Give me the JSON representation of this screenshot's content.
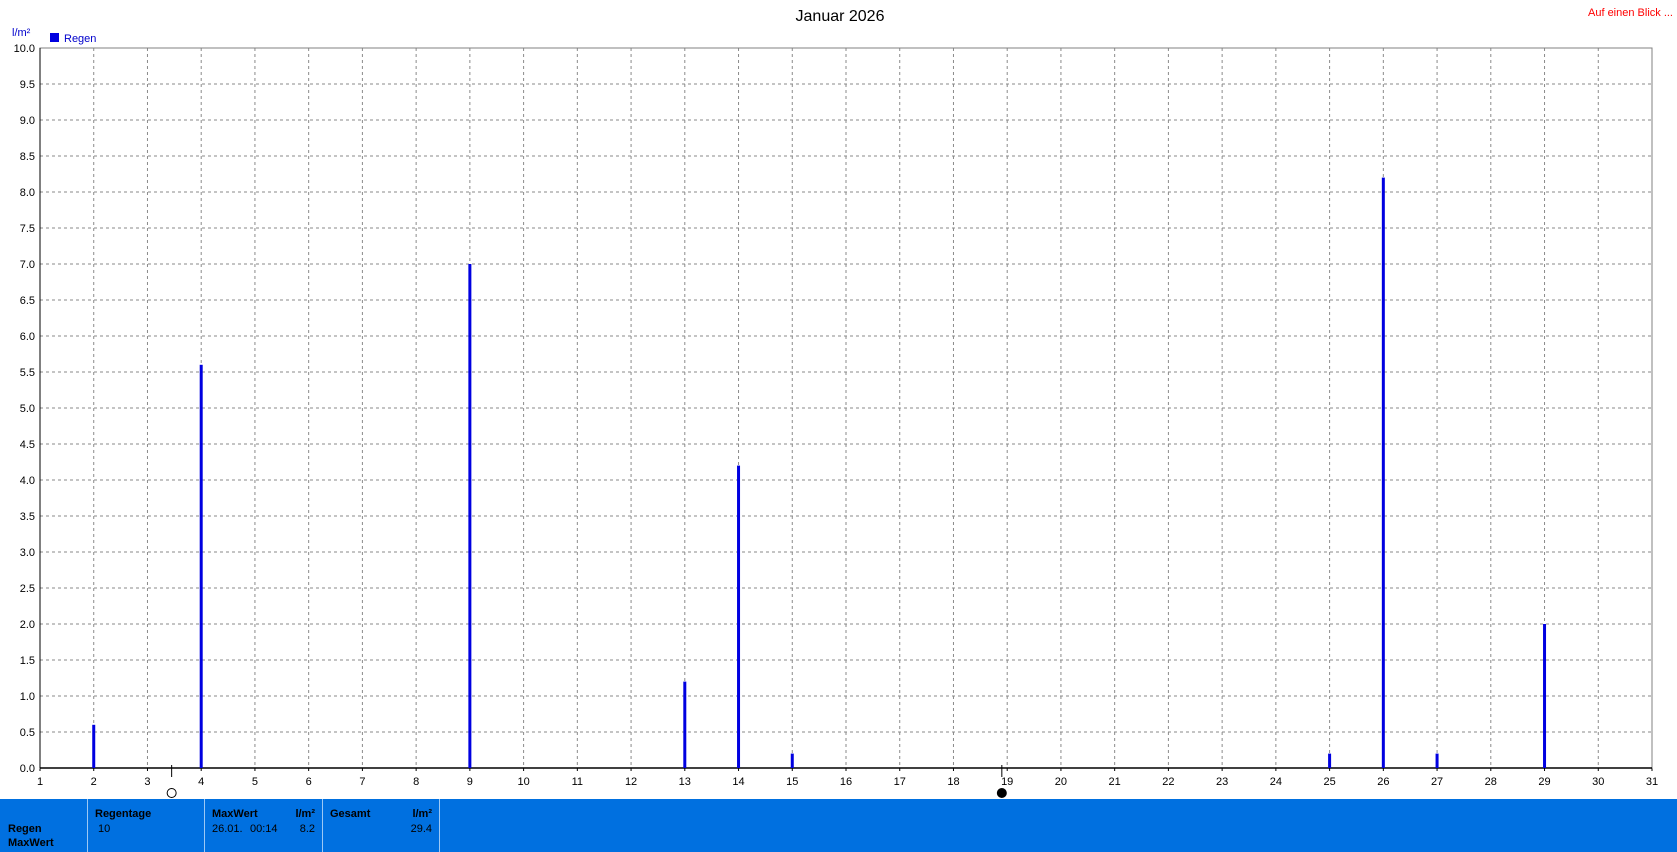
{
  "chart_data": {
    "type": "bar",
    "title": "Januar 2026",
    "ylabel": "l/m²",
    "ylim": [
      0,
      10
    ],
    "y_ticks": [
      "0.0",
      "0.5",
      "1.0",
      "1.5",
      "2.0",
      "2.5",
      "3.0",
      "3.5",
      "4.0",
      "4.5",
      "5.0",
      "5.5",
      "6.0",
      "6.5",
      "7.0",
      "7.5",
      "8.0",
      "8.5",
      "9.0",
      "9.5",
      "10.0"
    ],
    "xlim": [
      1,
      31
    ],
    "x_ticks": [
      "1",
      "2",
      "3",
      "4",
      "5",
      "6",
      "7",
      "8",
      "9",
      "10",
      "11",
      "12",
      "13",
      "14",
      "15",
      "16",
      "17",
      "18",
      "19",
      "20",
      "21",
      "22",
      "23",
      "24",
      "25",
      "26",
      "27",
      "28",
      "29",
      "30",
      "31"
    ],
    "grid": true,
    "legend_position": "top-left",
    "series": [
      {
        "name": "Regen",
        "color": "#0000e0",
        "points": [
          {
            "x": 2,
            "y": 0.6
          },
          {
            "x": 4,
            "y": 5.6
          },
          {
            "x": 9,
            "y": 7.0
          },
          {
            "x": 13,
            "y": 1.2
          },
          {
            "x": 14,
            "y": 4.2
          },
          {
            "x": 15,
            "y": 0.2
          },
          {
            "x": 25,
            "y": 0.2
          },
          {
            "x": 26,
            "y": 8.2
          },
          {
            "x": 27,
            "y": 0.2
          },
          {
            "x": 29,
            "y": 2.0
          }
        ]
      }
    ],
    "moon_markers": [
      {
        "x": 3.45,
        "phase": "full-moon"
      },
      {
        "x": 18.9,
        "phase": "new-moon"
      }
    ]
  },
  "link": {
    "label": "Auf einen Blick ..."
  },
  "stats": {
    "row_labels": [
      "Regen",
      "MaxWert"
    ],
    "regentage": {
      "header": "Regentage",
      "value": "10"
    },
    "maxwert": {
      "header": "MaxWert",
      "unit": "l/m²",
      "date": "26.01.",
      "time": "00:14",
      "value": "8.2"
    },
    "gesamt": {
      "header": "Gesamt",
      "unit": "l/m²",
      "value": "29.4"
    },
    "bar_color": "#0070e0"
  }
}
